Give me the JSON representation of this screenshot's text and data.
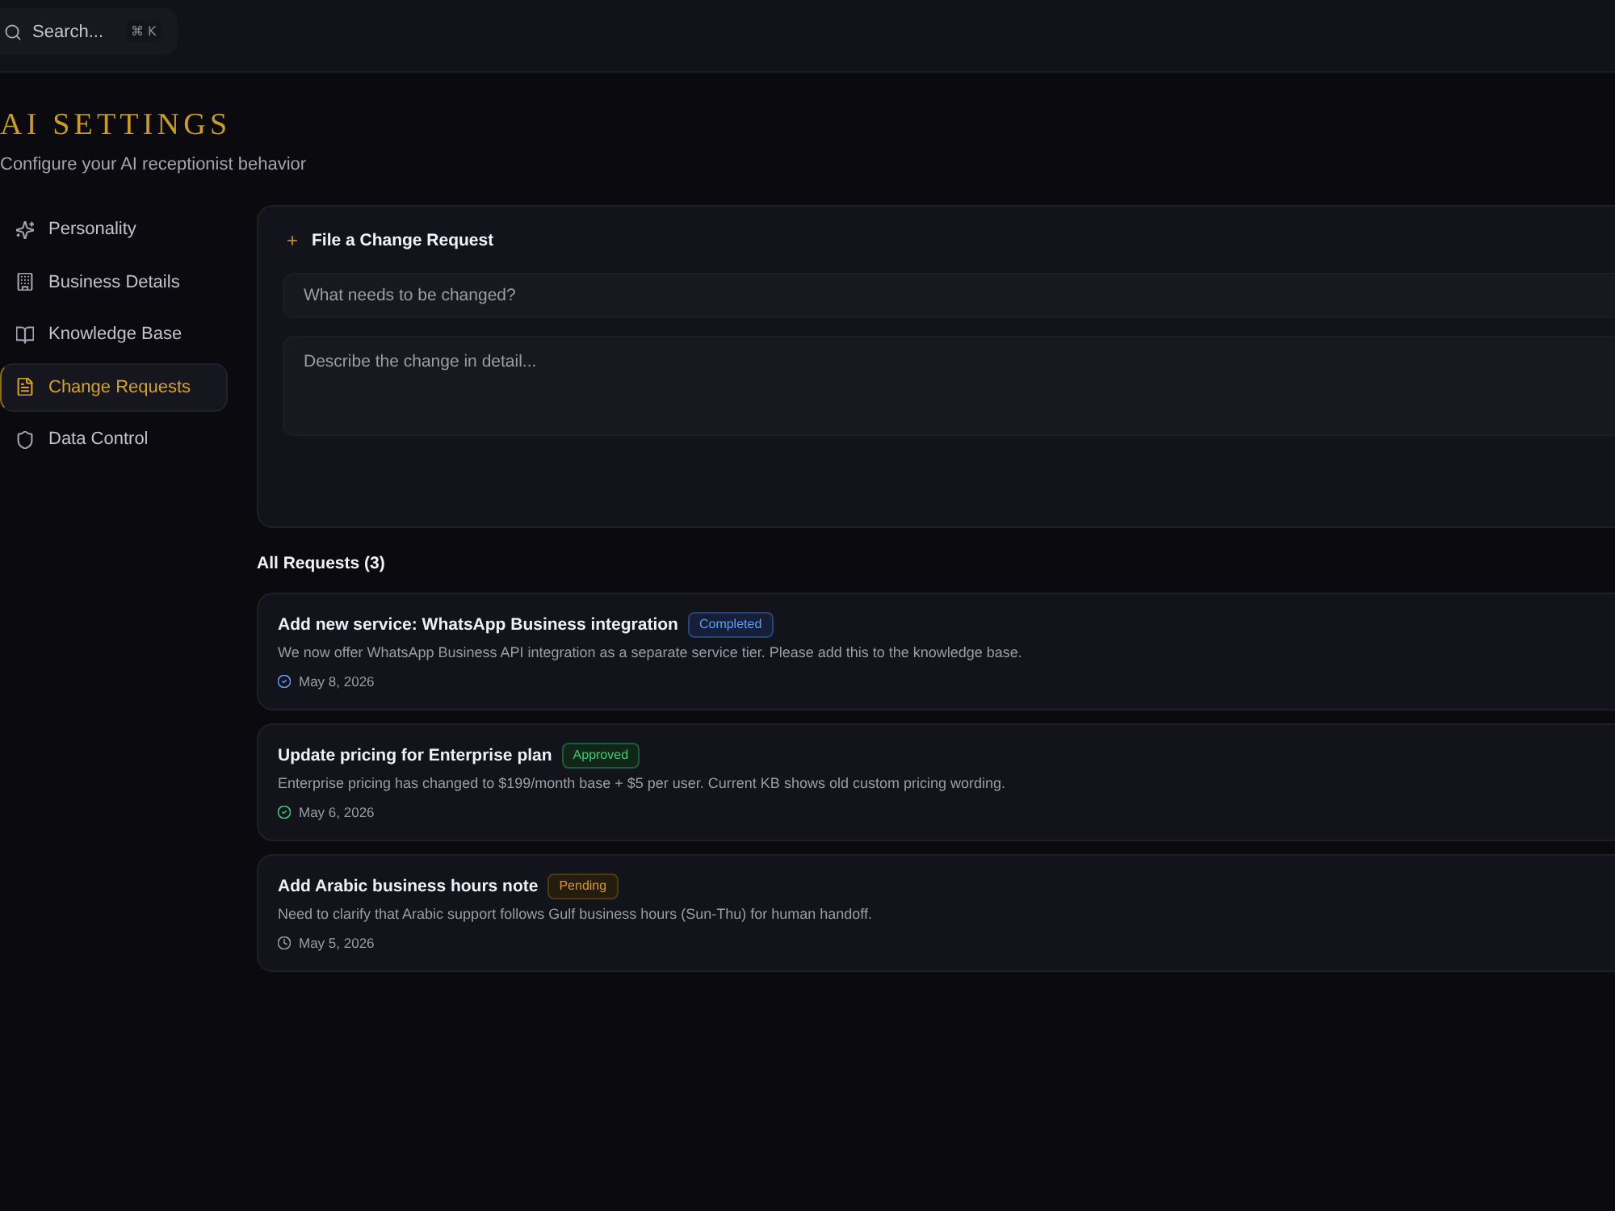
{
  "topbar": {
    "search": {
      "placeholder": "Search...",
      "shortcut": "⌘ K"
    }
  },
  "header": {
    "title": "AI SETTINGS",
    "subtitle": "Configure your AI receptionist behavior"
  },
  "sidebar": {
    "items": [
      {
        "label": "Personality",
        "selected": false
      },
      {
        "label": "Business Details",
        "selected": false
      },
      {
        "label": "Knowledge Base",
        "selected": false
      },
      {
        "label": "Change Requests",
        "selected": true
      },
      {
        "label": "Data Control",
        "selected": false
      }
    ]
  },
  "change_request_form": {
    "title": "File a Change Request",
    "subject": {
      "placeholder": "What needs to be changed?"
    },
    "details": {
      "placeholder": "Describe the change in detail..."
    }
  },
  "requests": {
    "heading": "All Requests (3)",
    "items": [
      {
        "kind": "completed",
        "title": "Add new service: WhatsApp Business integration",
        "status": "Completed",
        "description": "We now offer WhatsApp Business API integration as a separate service tier. Please add this to the knowledge base.",
        "date": "May 8, 2026"
      },
      {
        "kind": "approved",
        "title": "Update pricing for Enterprise plan",
        "status": "Approved",
        "description": "Enterprise pricing has changed to $199/month base + $5 per user. Current KB shows old custom pricing wording.",
        "date": "May 6, 2026"
      },
      {
        "kind": "pending",
        "title": "Add Arabic business hours note",
        "status": "Pending",
        "description": "Need to clarify that Arabic support follows Gulf business hours (Sun-Thu) for human handoff.",
        "date": "May 5, 2026"
      }
    ]
  }
}
